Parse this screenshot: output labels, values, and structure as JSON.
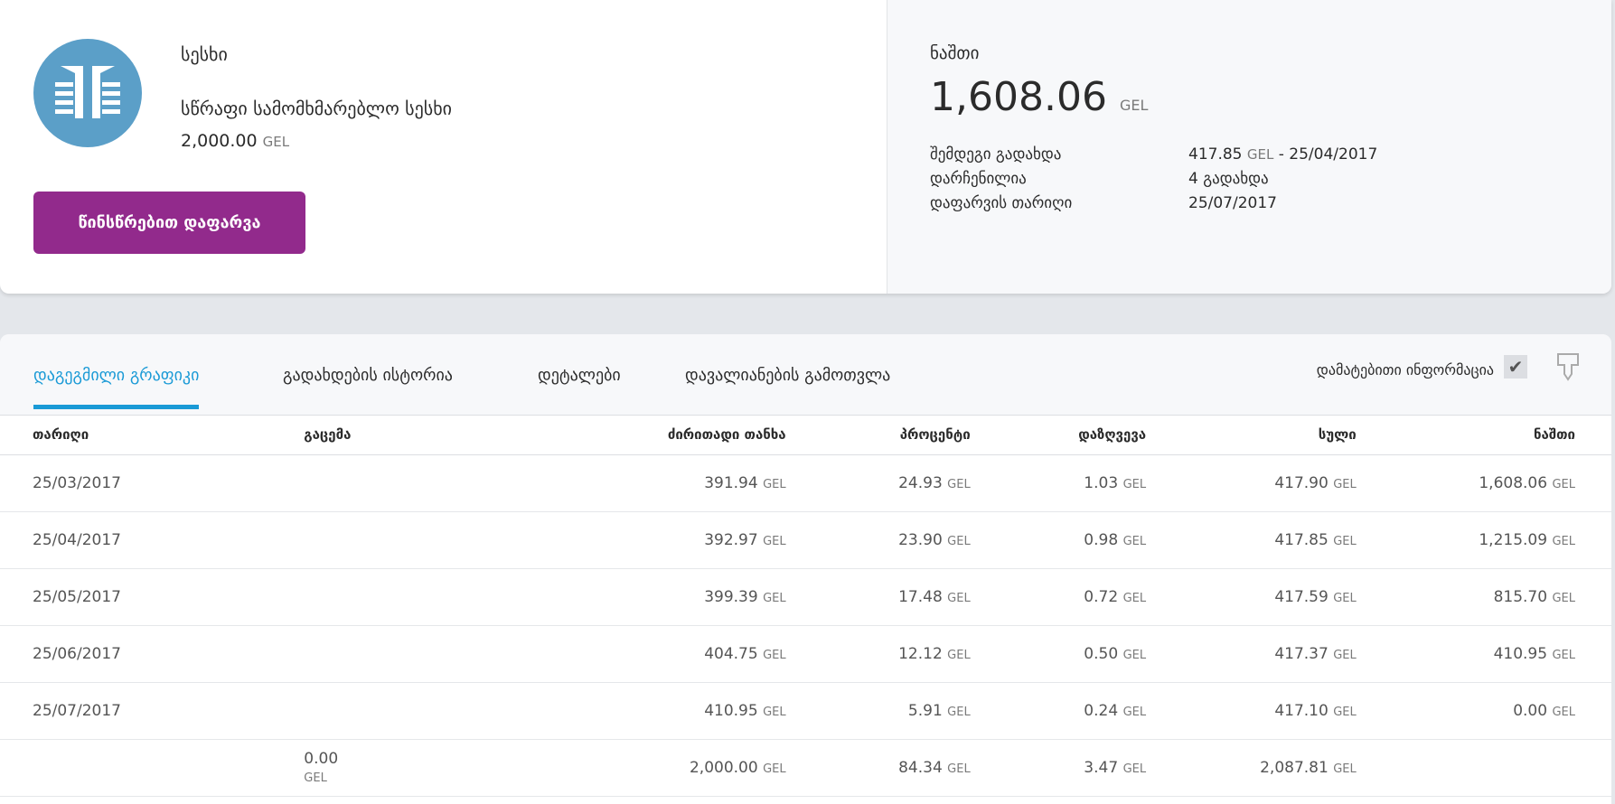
{
  "loan": {
    "type_label": "სესხი",
    "product": "სწრაფი სამომხმარებლო სესხი",
    "amount": "2,000.00",
    "currency": "GEL",
    "prepay_button": "წინსწრებით დაფარვა"
  },
  "balance": {
    "label": "ნაშთი",
    "amount": "1,608.06",
    "currency": "GEL",
    "next_payment_label": "შემდეგი გადახდა",
    "next_payment_amount": "417.85",
    "next_payment_currency": "GEL",
    "next_payment_date": "- 25/04/2017",
    "remaining_label": "დარჩენილია",
    "remaining_value": "4 გადახდა",
    "maturity_label": "დაფარვის თარიღი",
    "maturity_value": "25/07/2017"
  },
  "tabs": [
    {
      "label": "დაგეგმილი გრაფიკი"
    },
    {
      "label": "გადახდების ისტორია"
    },
    {
      "label": "დეტალები"
    },
    {
      "label": "დავალიანების გამოთვლა"
    }
  ],
  "extra_info_label": "დამატებითი ინფორმაცია",
  "table": {
    "headers": [
      "თარიღი",
      "გაცემა",
      "ძირითადი თანხა",
      "პროცენტი",
      "დაზღვევა",
      "სული",
      "ნაშთი"
    ],
    "currency": "GEL",
    "rows": [
      [
        "25/03/2017",
        "",
        "391.94",
        "24.93",
        "1.03",
        "417.90",
        "1,608.06"
      ],
      [
        "25/04/2017",
        "",
        "392.97",
        "23.90",
        "0.98",
        "417.85",
        "1,215.09"
      ],
      [
        "25/05/2017",
        "",
        "399.39",
        "17.48",
        "0.72",
        "417.59",
        "815.70"
      ],
      [
        "25/06/2017",
        "",
        "404.75",
        "12.12",
        "0.50",
        "417.37",
        "410.95"
      ],
      [
        "25/07/2017",
        "",
        "410.95",
        "5.91",
        "0.24",
        "417.10",
        "0.00"
      ]
    ],
    "totals": [
      "",
      "0.00",
      "2,000.00",
      "84.34",
      "3.47",
      "2,087.81",
      ""
    ]
  }
}
